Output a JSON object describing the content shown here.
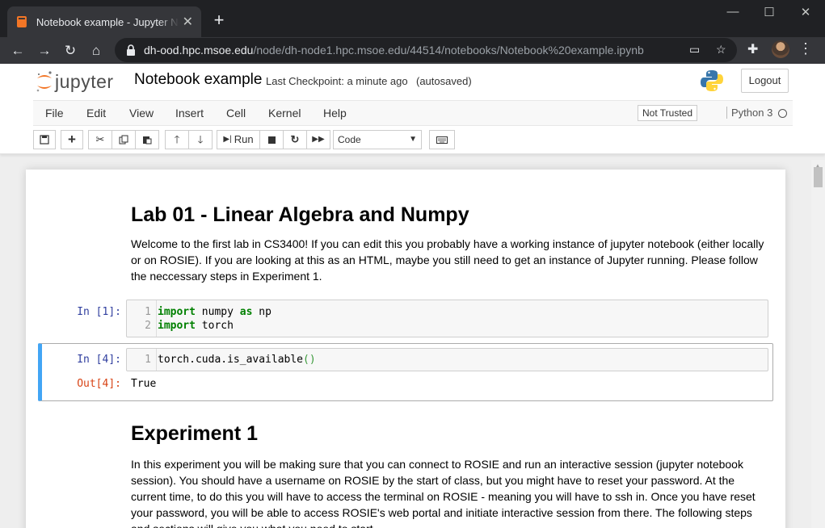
{
  "browser": {
    "tab_title": "Notebook example - Jupyter Notebook",
    "url_host": "dh-ood.hpc.msoe.edu",
    "url_path": "/node/dh-node1.hpc.msoe.edu/44514/notebooks/Notebook%20example.ipynb"
  },
  "header": {
    "logo_text": "jupyter",
    "notebook_name": "Notebook example",
    "checkpoint": "Last Checkpoint: a minute ago",
    "autosave": "(autosaved)",
    "logout": "Logout"
  },
  "menu": {
    "items": [
      "File",
      "Edit",
      "View",
      "Insert",
      "Cell",
      "Kernel",
      "Help"
    ],
    "trust": "Not Trusted",
    "kernel": "Python 3"
  },
  "toolbar": {
    "run_label": "Run",
    "cell_type": "Code"
  },
  "cells": {
    "title": "Lab 01 - Linear Algebra and Numpy",
    "intro": "Welcome to the first lab in CS3400! If you can edit this you probably have a working instance of jupyter notebook (either locally or on ROSIE). If you are looking at this as an HTML, maybe you still need to get an instance of Jupyter running. Please follow the neccessary steps in Experiment 1.",
    "code1": {
      "prompt": "In [1]:",
      "lines": [
        {
          "num": "1",
          "kw": "import",
          "rest1": " numpy ",
          "kw2": "as",
          "rest2": " np"
        },
        {
          "num": "2",
          "kw": "import",
          "rest1": " torch",
          "kw2": "",
          "rest2": ""
        }
      ]
    },
    "code2": {
      "prompt": "In [4]:",
      "line_num": "1",
      "code": "torch.cuda.is_available",
      "paren": "()",
      "out_prompt": "Out[4]:",
      "output": "True"
    },
    "heading2": "Experiment 1",
    "exp_text": "In this experiment you will be making sure that you can connect to ROSIE and run an interactive session (jupyter notebook session). You should have a username on ROSIE by the start of class, but you might have to reset your password. At the current time, to do this you will have to access the terminal on ROSIE - meaning you will have to ssh in. Once you have reset your password, you will be able to access ROSIE's web portal and initiate interactive session from there. The following steps and sections will give you what you need to start."
  }
}
